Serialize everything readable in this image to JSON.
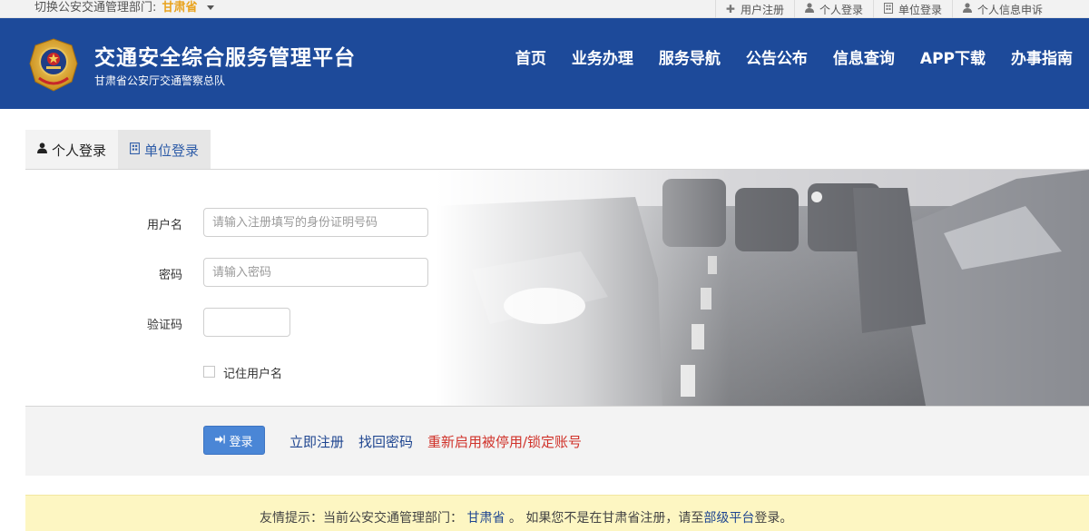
{
  "topbar": {
    "switch_label": "切换公安交通管理部门:",
    "province": "甘肃省",
    "links": [
      {
        "icon": "plus-icon",
        "label": "用户注册"
      },
      {
        "icon": "user-icon",
        "label": "个人登录"
      },
      {
        "icon": "building-icon",
        "label": "单位登录"
      },
      {
        "icon": "user-icon",
        "label": "个人信息申诉"
      }
    ]
  },
  "header": {
    "title": "交通安全综合服务管理平台",
    "subtitle": "甘肃省公安厅交通警察总队",
    "nav": [
      "首页",
      "业务办理",
      "服务导航",
      "公告公布",
      "信息查询",
      "APP下载",
      "办事指南"
    ]
  },
  "tabs": {
    "personal": "个人登录",
    "unit": "单位登录"
  },
  "form": {
    "username_label": "用户名",
    "username_placeholder": "请输入注册填写的身份证明号码",
    "password_label": "密码",
    "password_placeholder": "请输入密码",
    "captcha_label": "验证码",
    "remember_label": "记住用户名"
  },
  "actions": {
    "login": "登录",
    "register": "立即注册",
    "recover": "找回密码",
    "reactivate": "重新启用被停用/锁定账号"
  },
  "notice": {
    "prefix": "友情提示：当前公安交通管理部门：",
    "dept": "甘肃省",
    "middle": "。 如果您不是在甘肃省注册，请至",
    "link": "部级平台",
    "suffix": "登录。"
  },
  "colors": {
    "header_bg": "#1d4a9a",
    "accent_gold": "#e9a31e",
    "login_button": "#4a86d6",
    "link_blue": "#1f4690",
    "warning_red": "#d0322a",
    "notice_bg": "#fdf6c2"
  }
}
